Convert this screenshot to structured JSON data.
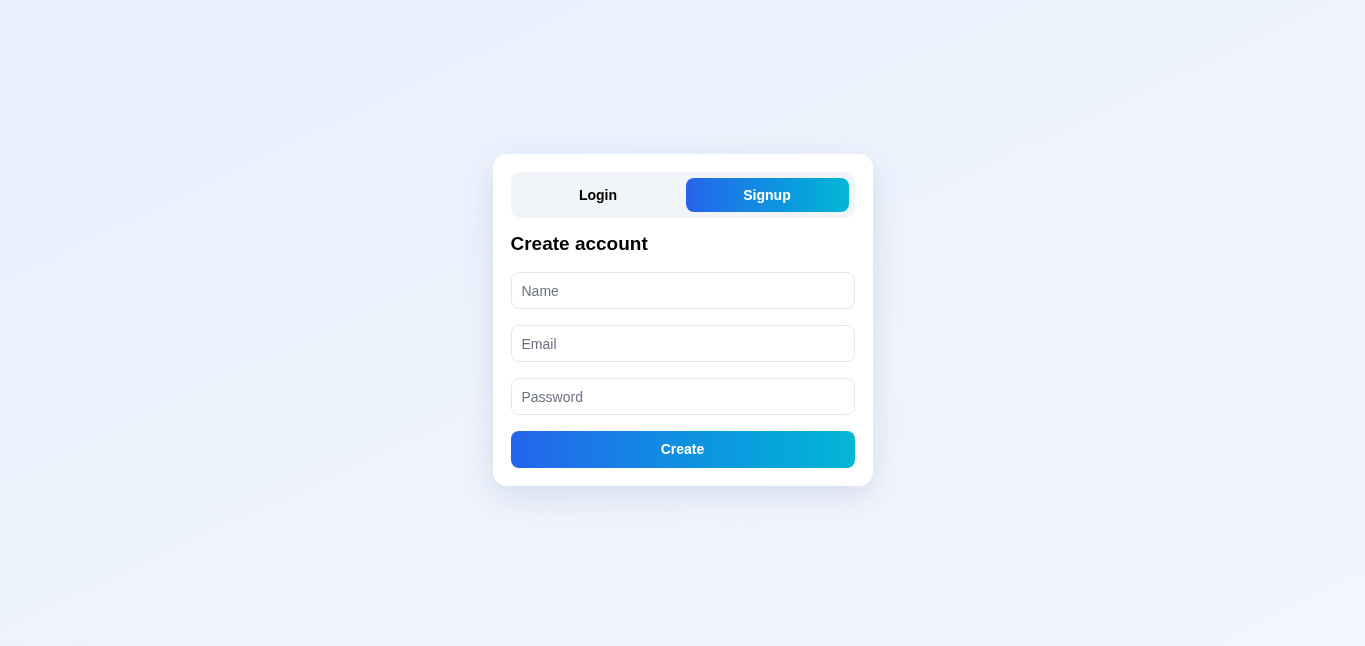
{
  "tabs": [
    {
      "label": "Login",
      "selected": false
    },
    {
      "label": "Signup",
      "selected": true
    }
  ],
  "heading": "Create account",
  "fields": [
    {
      "placeholder": "Name"
    },
    {
      "placeholder": "Email"
    },
    {
      "placeholder": "Password"
    }
  ],
  "submit": "Create"
}
